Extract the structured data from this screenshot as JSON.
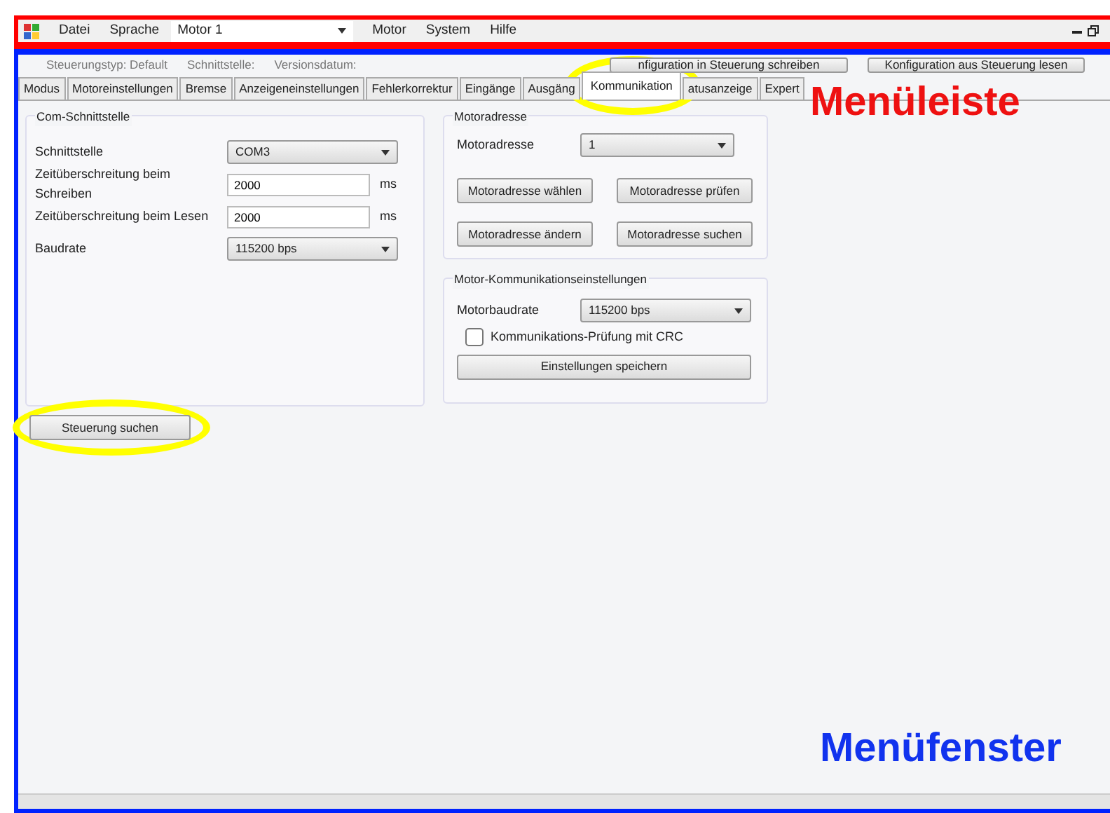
{
  "menu_bar": {
    "items": [
      "Datei",
      "Sprache"
    ],
    "motor_select": {
      "value": "Motor 1"
    },
    "items_after": [
      "Motor",
      "System",
      "Hilfe"
    ]
  },
  "info_bar": {
    "texts": [
      "Steuerungstyp: Default",
      "Schnittstelle:",
      "Versionsdatum:"
    ],
    "buttons": [
      "nfiguration in Steuerung schreiben",
      "Konfiguration aus Steuerung lesen"
    ]
  },
  "tabs": [
    {
      "label": "Modus",
      "selected": false,
      "highlighted": false
    },
    {
      "label": "Motoreinstellungen",
      "selected": false,
      "highlighted": false
    },
    {
      "label": "Bremse",
      "selected": false,
      "highlighted": false
    },
    {
      "label": "Anzeigeneinstellungen",
      "selected": false,
      "highlighted": false
    },
    {
      "label": "Fehlerkorrektur",
      "selected": false,
      "highlighted": false
    },
    {
      "label": "Eingänge",
      "selected": false,
      "highlighted": false
    },
    {
      "label": "Ausgäng",
      "selected": false,
      "highlighted": false
    },
    {
      "label": "Kommunikation",
      "selected": true,
      "highlighted": true
    },
    {
      "label": "atusanzeige",
      "selected": false,
      "highlighted": false
    },
    {
      "label": "Expert",
      "selected": false,
      "highlighted": false
    }
  ],
  "com_group": {
    "title": "Com-Schnittstelle",
    "rows": [
      {
        "kind": "select",
        "label": "Schnittstelle",
        "value": "COM3"
      },
      {
        "kind": "input",
        "label": "Zeitüberschreitung beim Schreiben",
        "value": "2000",
        "unit": "ms"
      },
      {
        "kind": "input",
        "label": "Zeitüberschreitung beim Lesen",
        "value": "2000",
        "unit": "ms"
      },
      {
        "kind": "select",
        "label": "Baudrate",
        "value": "115200 bps"
      }
    ]
  },
  "address_group": {
    "title": "Motoradresse",
    "label": "Motoradresse",
    "value": "1",
    "buttons": [
      "Motoradresse wählen",
      "Motoradresse prüfen",
      "Motoradresse ändern",
      "Motoradresse suchen"
    ]
  },
  "comm_group": {
    "title": "Motor-Kommunikationseinstellungen",
    "label": "Motorbaudrate",
    "value": "115200 bps",
    "checkbox": {
      "label": "Kommunikations-Prüfung mit CRC",
      "checked": false
    },
    "button": "Einstellungen speichern"
  },
  "search_button": {
    "label": "Steuerung suchen",
    "highlighted": true
  },
  "annotations": [
    {
      "text": "Menüleiste",
      "color": "#ee1111"
    },
    {
      "text": "Menüfenster",
      "color": "#1133ee"
    }
  ]
}
